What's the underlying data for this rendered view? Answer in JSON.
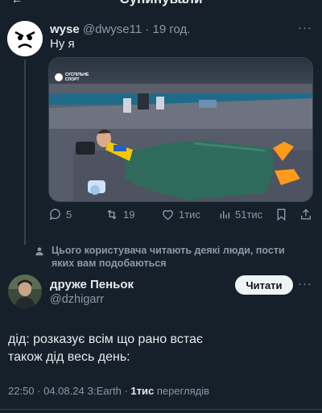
{
  "header": {
    "title": "Cупинували"
  },
  "tweet1": {
    "name": "wyse",
    "handle": "@dwyse11",
    "separator": "·",
    "time": "19 год.",
    "text": "Ну я",
    "media_watermark": "СУСПІЛЬНЕ СПОРТ",
    "stats": {
      "replies": "5",
      "retweets": "19",
      "likes": "1тис",
      "views": "51тис"
    }
  },
  "notice": "Цього користувача читають деякі люди, пости яких вам подобаються",
  "tweet2": {
    "name": "друже Пеньок",
    "handle": "@dzhigarr",
    "follow_label": "Читати",
    "text_line1": "дід: розказує всім що рано встає",
    "text_line2": "також дід весь день:",
    "meta_time": "22:50 · 04.08.24 З:Earth ·",
    "meta_views_count": "1тис",
    "meta_views_label": "переглядів"
  },
  "icons": [
    "back-arrow-icon",
    "more-icon",
    "reply-icon",
    "retweet-icon",
    "like-icon",
    "views-icon",
    "bookmark-icon",
    "share-icon",
    "person-icon"
  ],
  "colors": {
    "background": "#15202b",
    "text": "#e7e9ea",
    "muted": "#8b98a5",
    "border": "#38444d",
    "sleeping_bag": "#2f6b5c",
    "shoes": "#ff9a1a"
  }
}
